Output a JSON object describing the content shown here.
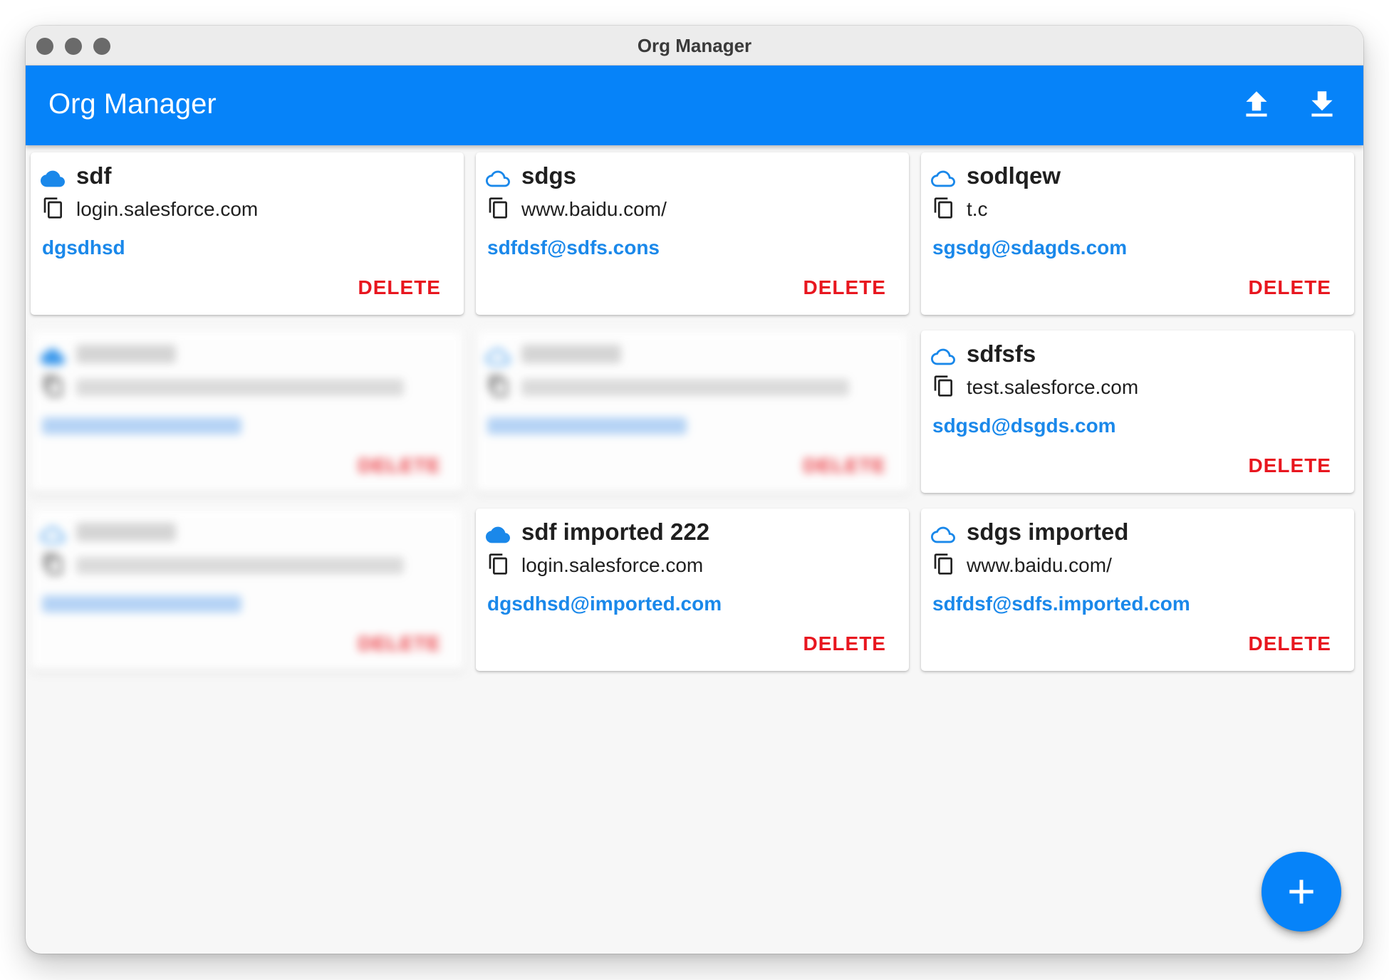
{
  "window": {
    "title": "Org Manager"
  },
  "appbar": {
    "title": "Org Manager",
    "actions": [
      {
        "name": "upload",
        "icon": "upload-icon"
      },
      {
        "name": "download",
        "icon": "download-icon"
      }
    ]
  },
  "colors": {
    "accent": "#0683f9",
    "link": "#1a88ea",
    "delete": "#e8161f",
    "background": "#f7f7f7"
  },
  "delete_label": "DELETE",
  "orgs": [
    {
      "name": "sdf",
      "url": "login.salesforce.com",
      "username": "dgsdhsd",
      "cloud_icon": "cloud-filled-icon",
      "blurred": false
    },
    {
      "name": "sdgs",
      "url": "www.baidu.com/",
      "username": "sdfdsf@sdfs.cons",
      "cloud_icon": "cloud-outline-icon",
      "blurred": false
    },
    {
      "name": "sodlqew",
      "url": "t.c",
      "username": "sgsdg@sdagds.com",
      "cloud_icon": "cloud-outline-icon",
      "blurred": false
    },
    {
      "name": "",
      "url": "",
      "username": "",
      "cloud_icon": "cloud-filled-icon",
      "blurred": true
    },
    {
      "name": "",
      "url": "",
      "username": "",
      "cloud_icon": "cloud-outline-icon",
      "blurred": true
    },
    {
      "name": "sdfsfs",
      "url": "test.salesforce.com",
      "username": "sdgsd@dsgds.com",
      "cloud_icon": "cloud-outline-icon",
      "blurred": false
    },
    {
      "name": "",
      "url": "",
      "username": "",
      "cloud_icon": "cloud-outline-icon",
      "blurred": true
    },
    {
      "name": "sdf imported 222",
      "url": "login.salesforce.com",
      "username": "dgsdhsd@imported.com",
      "cloud_icon": "cloud-filled-icon",
      "blurred": false
    },
    {
      "name": "sdgs imported",
      "url": "www.baidu.com/",
      "username": "sdfdsf@sdfs.imported.com",
      "cloud_icon": "cloud-outline-icon",
      "blurred": false
    }
  ],
  "fab": {
    "icon": "plus-icon"
  }
}
